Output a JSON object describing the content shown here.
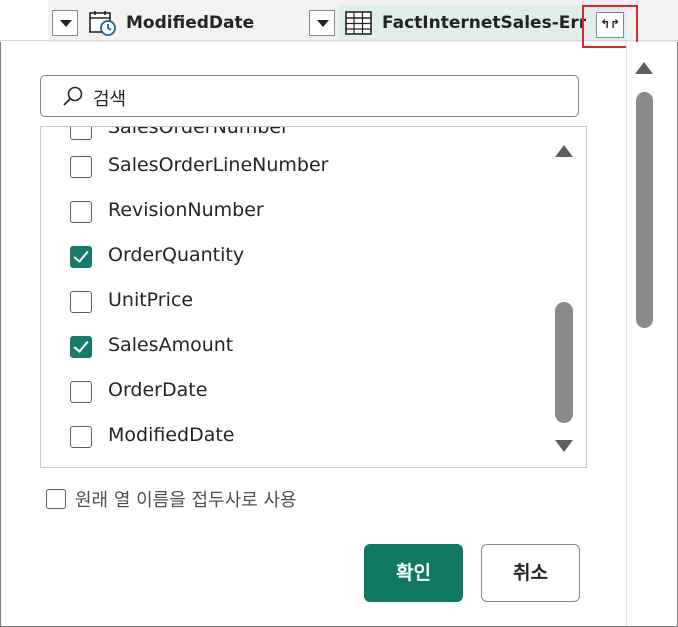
{
  "header": {
    "col1_label": "ModifiedDate",
    "col1_icon": "calendar-clock-icon",
    "col2_label": "FactInternetSales-Error",
    "col2_icon": "table-icon",
    "expand_icon": "expand-columns-icon",
    "expand_glyph": "↰↱"
  },
  "search": {
    "placeholder": "검색",
    "icon": "search-icon"
  },
  "columns": [
    {
      "label": "SalesOrderNumber",
      "checked": false
    },
    {
      "label": "SalesOrderLineNumber",
      "checked": false
    },
    {
      "label": "RevisionNumber",
      "checked": false
    },
    {
      "label": "OrderQuantity",
      "checked": true
    },
    {
      "label": "UnitPrice",
      "checked": false
    },
    {
      "label": "SalesAmount",
      "checked": true
    },
    {
      "label": "OrderDate",
      "checked": false
    },
    {
      "label": "ModifiedDate",
      "checked": false
    }
  ],
  "option": {
    "label": "원래 열 이름을 접두사로 사용",
    "checked": false
  },
  "buttons": {
    "ok": "확인",
    "cancel": "취소"
  },
  "colors": {
    "accent": "#117865",
    "highlight": "#e3242b",
    "query_tab": "#dfeeea"
  }
}
